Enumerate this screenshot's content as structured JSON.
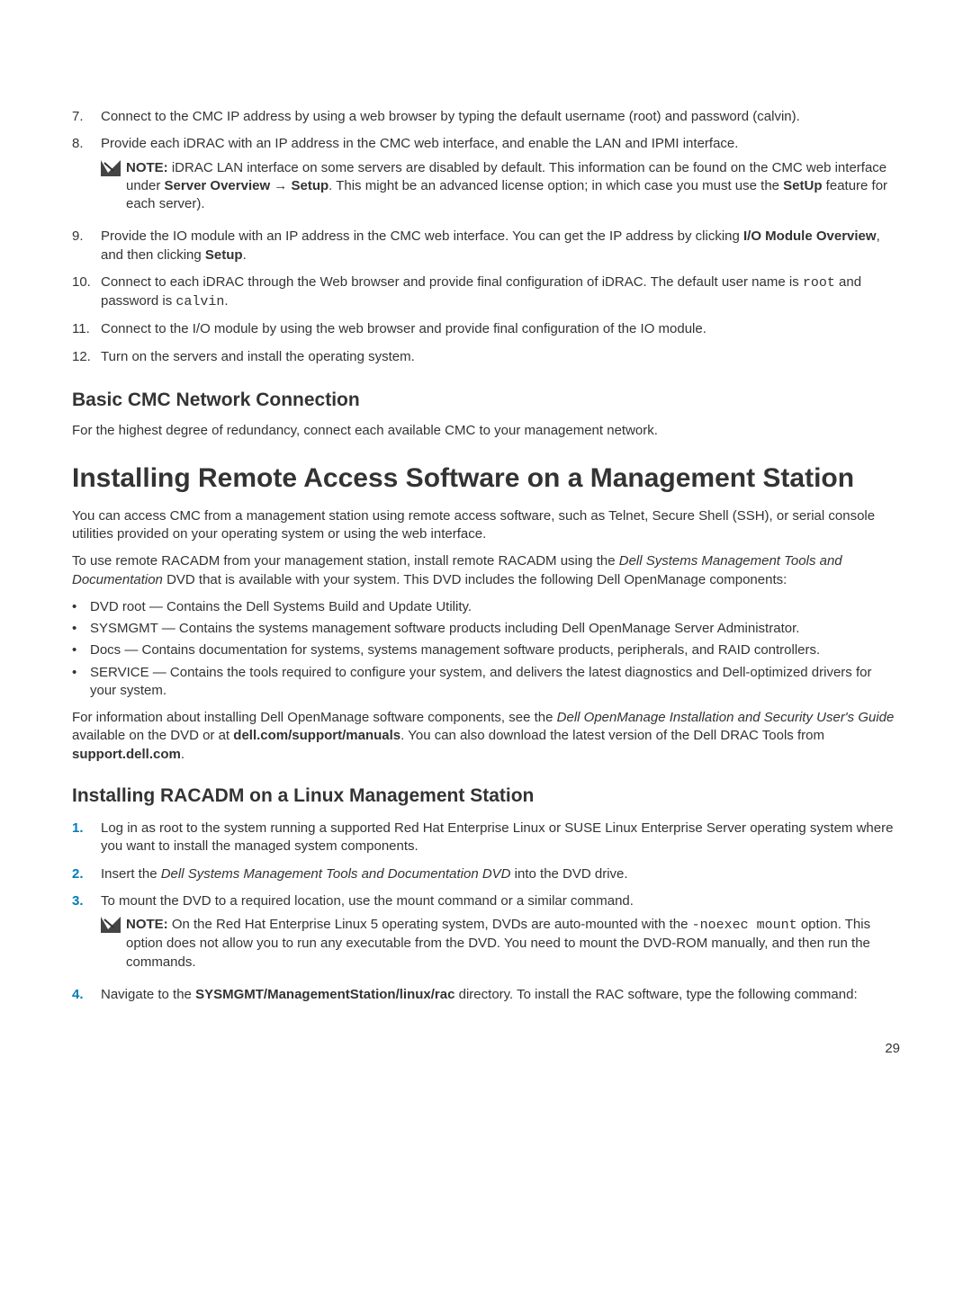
{
  "steps1": [
    {
      "num": "7.",
      "text": "Connect to the CMC IP address by using a web browser by typing the default username (root) and password (calvin)."
    },
    {
      "num": "8.",
      "text": "Provide each iDRAC with an IP address in the CMC web interface, and enable the LAN and IPMI interface."
    },
    {
      "num": "9.",
      "pre": "Provide the IO module with an IP address in the CMC web interface. You can get the IP address by clicking ",
      "bold1": "I/O Module Overview",
      "mid": ", and then clicking ",
      "bold2": "Setup",
      "post": "."
    },
    {
      "num": "10.",
      "pre": "Connect to each iDRAC through the Web browser and provide final configuration of iDRAC. The default user name is ",
      "mono1": "root",
      "mid": " and password is ",
      "mono2": "calvin",
      "post": "."
    },
    {
      "num": "11.",
      "text": "Connect to the I/O module by using the web browser and provide final configuration of the IO module."
    },
    {
      "num": "12.",
      "text": "Turn on the servers and install the operating system."
    }
  ],
  "note1": {
    "label": "NOTE:",
    "pre": " iDRAC LAN interface on some servers are disabled by default. This information can be found on the CMC web interface under ",
    "bold1": "Server Overview",
    "arrow": " → ",
    "bold2": "Setup",
    "mid": ". This might be an advanced license option; in which case you must use the ",
    "bold3": "SetUp",
    "post": " feature for each server)."
  },
  "section_basic_title": "Basic CMC Network Connection",
  "section_basic_text": "For the highest degree of redundancy, connect each available CMC to your management network.",
  "main_title": "Installing Remote Access Software on a Management Station",
  "main_p1": "You can access CMC from a management station using remote access software, such as Telnet, Secure Shell (SSH), or serial console utilities provided on your operating system or using the web interface.",
  "main_p2_pre": "To use remote RACADM from your management station, install remote RACADM using the ",
  "main_p2_italic": "Dell Systems Management Tools and Documentation",
  "main_p2_post": " DVD that is available with your system. This DVD includes the following Dell OpenManage components:",
  "bullets1": [
    "DVD root — Contains the Dell Systems Build and Update Utility.",
    "SYSMGMT — Contains the systems management software products including Dell OpenManage Server Administrator.",
    "Docs — Contains documentation for systems, systems management software products, peripherals, and RAID controllers.",
    "SERVICE — Contains the tools required to configure your system, and delivers the latest diagnostics and Dell-optimized drivers for your system."
  ],
  "main_p3_pre": "For information about installing Dell OpenManage software components, see the ",
  "main_p3_italic": "Dell OpenManage Installation and Security User's Guide",
  "main_p3_mid": " available on the DVD or at ",
  "main_p3_bold1": "dell.com/support/manuals",
  "main_p3_mid2": ". You can also download the latest version of the Dell DRAC Tools from ",
  "main_p3_bold2": "support.dell.com",
  "main_p3_post": ".",
  "sub_title": "Installing RACADM on a Linux Management Station",
  "steps2": [
    {
      "num": "1.",
      "text": "Log in as root to the system running a supported Red Hat Enterprise Linux or SUSE Linux Enterprise Server operating system where you want to install the managed system components."
    },
    {
      "num": "2.",
      "pre": "Insert the ",
      "italic": "Dell Systems Management Tools and Documentation DVD",
      "post": " into the DVD drive."
    },
    {
      "num": "3.",
      "text": "To mount the DVD to a required location, use the mount command or a similar command."
    },
    {
      "num": "4.",
      "pre": "Navigate to the ",
      "bold": "SYSMGMT/ManagementStation/linux/rac",
      "post": " directory. To install the RAC software, type the following command:"
    }
  ],
  "note2": {
    "label": "NOTE:",
    "pre": " On the Red Hat Enterprise Linux 5 operating system, DVDs are auto-mounted with the ",
    "mono1": "-noexec mount",
    "post": " option. This option does not allow you to run any executable from the DVD. You need to mount the DVD-ROM manually, and then run the commands."
  },
  "page_number": "29"
}
